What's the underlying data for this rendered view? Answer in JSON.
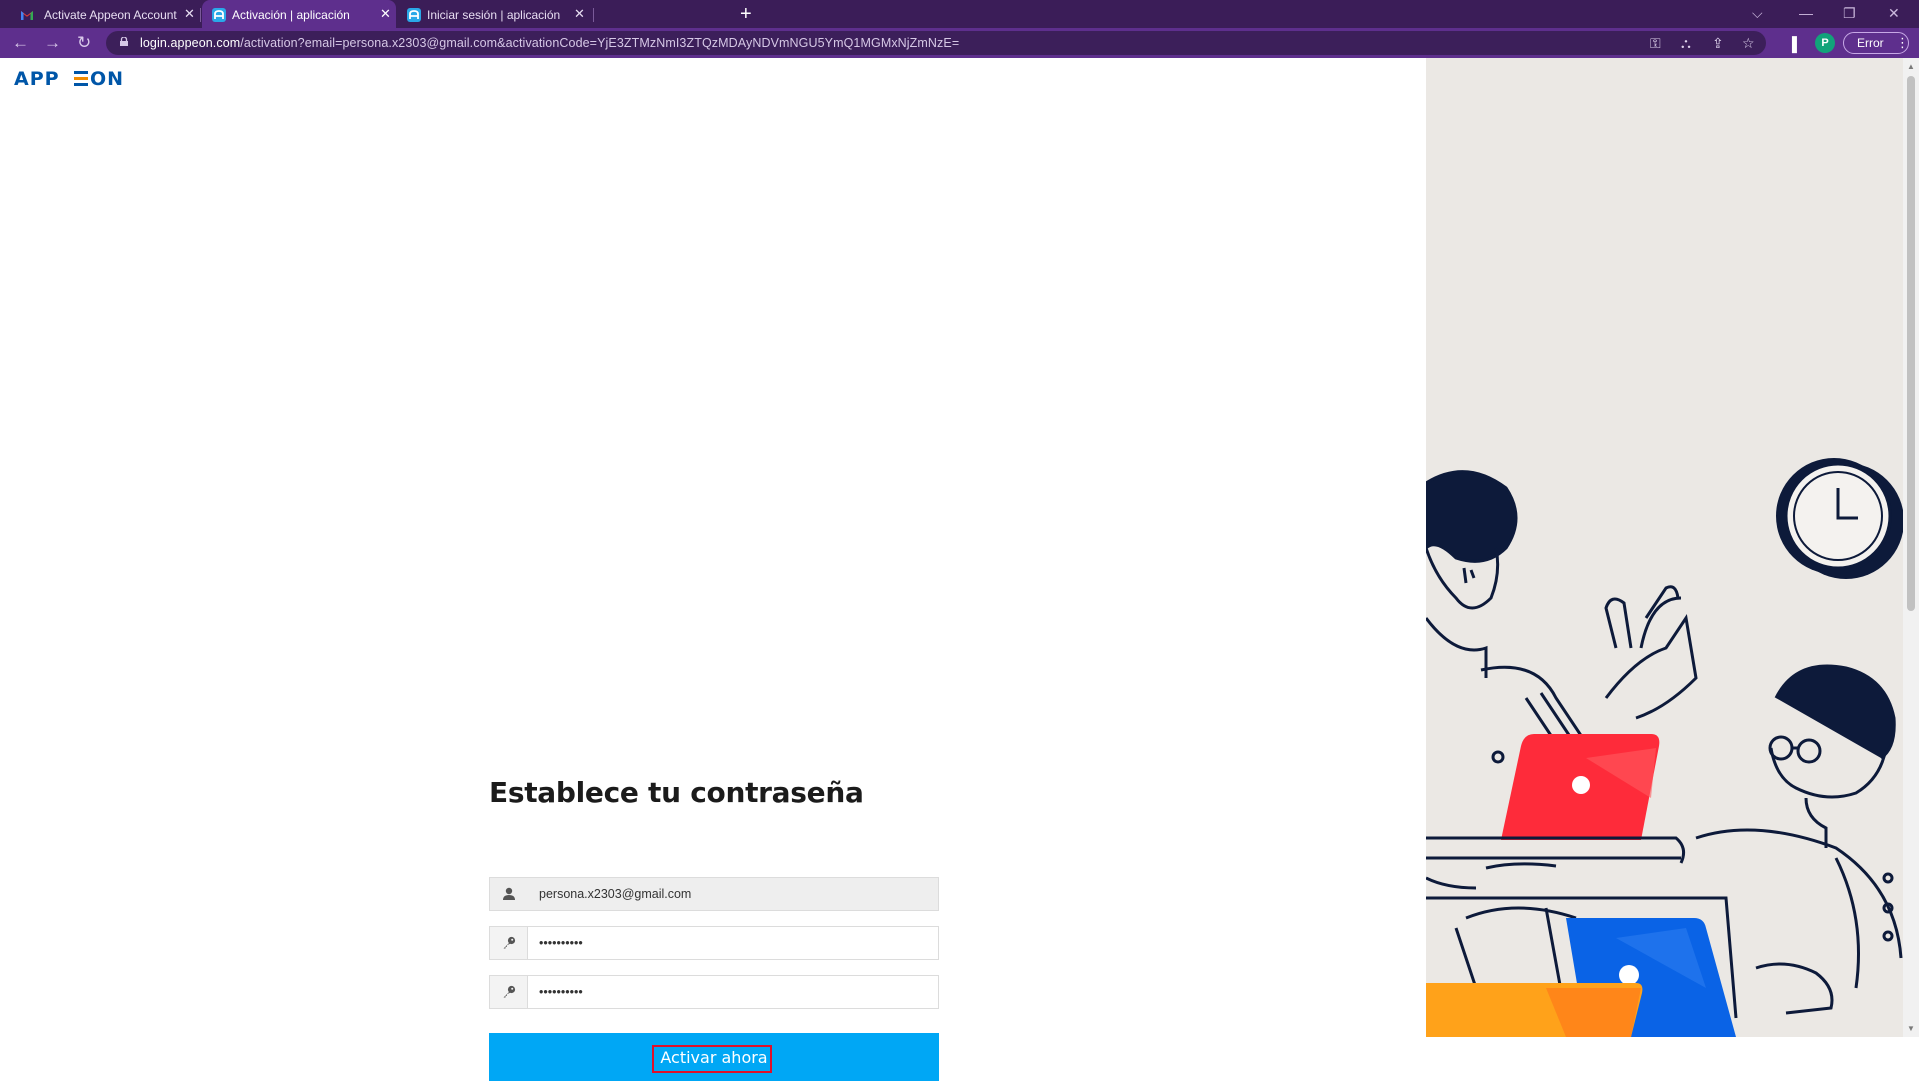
{
  "browser": {
    "tabs": [
      {
        "title": "Activate Appeon Account - perso",
        "active": false,
        "favicon": "gmail-icon"
      },
      {
        "title": "Activación | aplicación",
        "active": true,
        "favicon": "appeon-favicon"
      },
      {
        "title": "Iniciar sesión | aplicación",
        "active": false,
        "favicon": "appeon-favicon"
      }
    ],
    "url_host": "login.appeon.com",
    "url_rest": "/activation?email=persona.x2303@gmail.com&activationCode=YjE3ZTMzNmI3ZTQzMDAyNDVmNGU5YmQ1MGMxNjZmNzE=",
    "profile_initial": "P",
    "error_label": "Error",
    "colors": {
      "chrome_dark": "#3b1d58",
      "chrome": "#5e2f8d",
      "profile": "#12a37a"
    }
  },
  "page": {
    "logo_text": "APPEON",
    "form": {
      "title": "Establece tu contraseña",
      "email_value": "persona.x2303@gmail.com",
      "password_value": "••••••••••",
      "confirm_value": "••••••••••",
      "submit_label": "Activar ahora"
    },
    "colors": {
      "button": "#00a7f5",
      "highlight": "#e0102b",
      "art_bg": "#ebe8e4"
    }
  }
}
